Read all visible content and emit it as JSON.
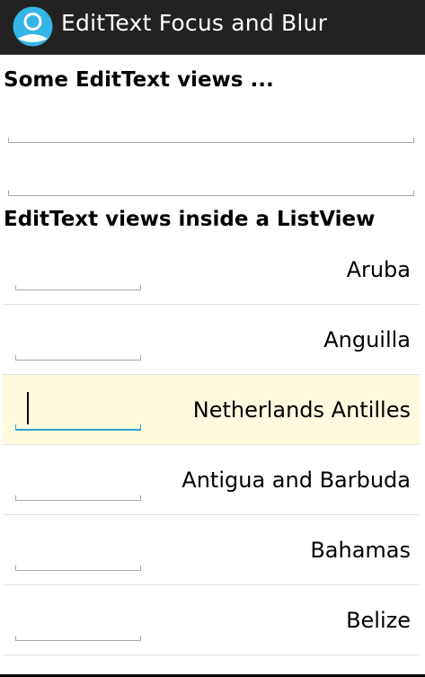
{
  "app": {
    "title": "EditText Focus and Blur",
    "icon": "app-face-icon",
    "icon_color": "#33b5e5"
  },
  "sections": {
    "top_header": "Some EditText views ...",
    "list_header": "EditText views inside a ListView"
  },
  "top_fields": [
    {
      "value": ""
    },
    {
      "value": ""
    }
  ],
  "list": {
    "focused_index": 2,
    "items": [
      {
        "country": "Aruba",
        "value": ""
      },
      {
        "country": "Anguilla",
        "value": ""
      },
      {
        "country": "Netherlands Antilles",
        "value": ""
      },
      {
        "country": "Antigua and Barbuda",
        "value": ""
      },
      {
        "country": "Bahamas",
        "value": ""
      },
      {
        "country": "Belize",
        "value": ""
      }
    ]
  },
  "colors": {
    "action_bar": "#222222",
    "focus_accent": "#2ea3d6",
    "focused_row_bg": "#fefadd"
  }
}
